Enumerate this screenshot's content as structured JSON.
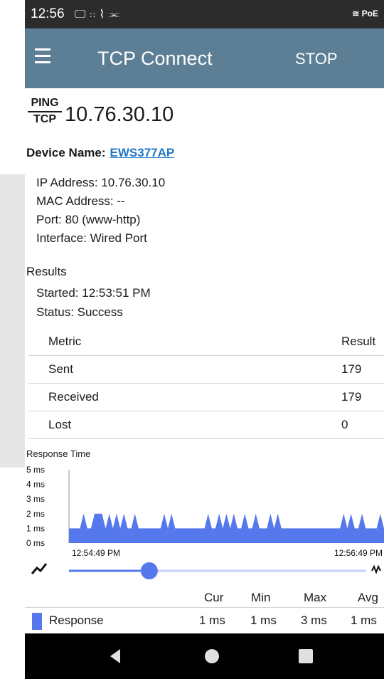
{
  "status_bar": {
    "time": "12:56",
    "icons": [
      "monitor-icon",
      "signal-100-icon",
      "activity-icon",
      "usb-icon"
    ],
    "right_label": "PoE"
  },
  "app_bar": {
    "title": "TCP Connect",
    "stop_label": "STOP"
  },
  "target": {
    "logo_top": "PING",
    "logo_bottom": "TCP",
    "ip": "10.76.30.10"
  },
  "device": {
    "label": "Device Name:",
    "name": "EWS377AP"
  },
  "info": [
    "IP Address: 10.76.30.10",
    "MAC Address: --",
    "Port: 80 (www-http)",
    "Interface: Wired Port"
  ],
  "results": {
    "title": "Results",
    "started": "Started: 12:53:51 PM",
    "status": "Status: Success"
  },
  "metrics": {
    "headers": [
      "Metric",
      "Result"
    ],
    "rows": [
      [
        "Sent",
        "179"
      ],
      [
        "Received",
        "179"
      ],
      [
        "Lost",
        "0"
      ]
    ]
  },
  "chart_data": {
    "type": "area",
    "title": "Response Time",
    "ylabel": "",
    "y_ticks": [
      "0 ms",
      "1 ms",
      "2 ms",
      "3 ms",
      "4 ms",
      "5 ms"
    ],
    "ylim": [
      0,
      5
    ],
    "x_labels": [
      "12:54:49 PM",
      "12:56:49 PM"
    ],
    "series": [
      {
        "name": "Response",
        "values": [
          1,
          1,
          1,
          1,
          2,
          1,
          1,
          2,
          2,
          2,
          1,
          2,
          1,
          2,
          1,
          2,
          1,
          1,
          2,
          1,
          1,
          1,
          1,
          1,
          1,
          1,
          2,
          1,
          2,
          1,
          1,
          1,
          1,
          1,
          1,
          1,
          1,
          1,
          2,
          1,
          1,
          2,
          1,
          2,
          1,
          2,
          1,
          1,
          2,
          1,
          1,
          2,
          1,
          1,
          1,
          2,
          1,
          2,
          1,
          1,
          1,
          1,
          1,
          1,
          1,
          1,
          1,
          1,
          1,
          1,
          1,
          1,
          1,
          1,
          1,
          2,
          1,
          2,
          1,
          1,
          2,
          1,
          1,
          1,
          1,
          2,
          1
        ]
      }
    ],
    "color": "#5578ec"
  },
  "slider": {
    "position": 0.27,
    "left_icon": "trend-line-icon",
    "right_icon": "trend-icon"
  },
  "summary": {
    "headers": [
      "Cur",
      "Min",
      "Max",
      "Avg"
    ],
    "row": {
      "name": "Response",
      "cur": "1 ms",
      "min": "1 ms",
      "max": "3 ms",
      "avg": "1 ms"
    }
  },
  "nav": {
    "back": "back-icon",
    "home": "home-icon",
    "recents": "recents-icon"
  }
}
